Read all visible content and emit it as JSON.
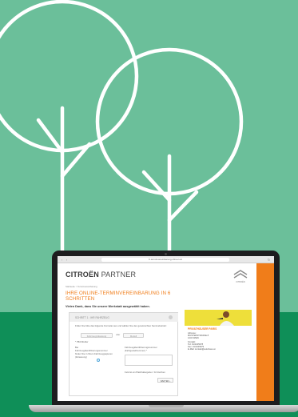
{
  "browser": {
    "url": "b.terminvereinbarung.citroen.at"
  },
  "site": {
    "logo_brand": "CITROËN",
    "logo_suffix": "PARTNER",
    "brand_mark_label": "CITROËN",
    "breadcrumb": "Startseite > Terminvereinbarung",
    "title_line1": "IHRE ONLINE-TERMINVEREINBARUNG IN 6",
    "title_line2": "SCHRITTEN",
    "lead": "Vielen Dank, dass Sie unsere Werkstatt ausgewählt haben."
  },
  "step": {
    "heading": "Schritt 1 : Ihr Fahrzeug",
    "intro": "Füllen Sie bitte das folgende Formular aus und wählen Sie den gewünschten Servicebetrieb:",
    "option_1": "Fahrzeugzulassung",
    "option_or": "oder",
    "option_2": "Modell",
    "required_note": "* Pflichtfelder",
    "field_left_1": "Bei",
    "field_left_2": "Fahrzeugidentifizierungsnummer",
    "field_left_3": "finden Sie in Ihrem Fahrzeugpapieren",
    "field_left_4": "(Zulassung)",
    "field_right_1": "Fahrzeugidentifizierungsnummer",
    "field_right_2": "(Fahrgestellnummer) *",
    "mileage_hint": "Feld ist ein Platzhaltergeber / 10 Zeichen",
    "next_button": "WEITER ›"
  },
  "dealer": {
    "name": "PRIVATHÄUSER PARIS",
    "line1": "Adresse:",
    "line2": "MUSTERSTRASSE 8",
    "line3": "1234 WIEN",
    "line4": "Kontakt:",
    "line5": "Tel: 01/2345678",
    "line6": "Fax: 01/2345679",
    "line7": "E-Mail: kontakt@autohaus.at"
  },
  "colors": {
    "sky_green": "#6bbf9a",
    "ground_green": "#0f8f58",
    "accent_orange": "#f07d1a"
  }
}
